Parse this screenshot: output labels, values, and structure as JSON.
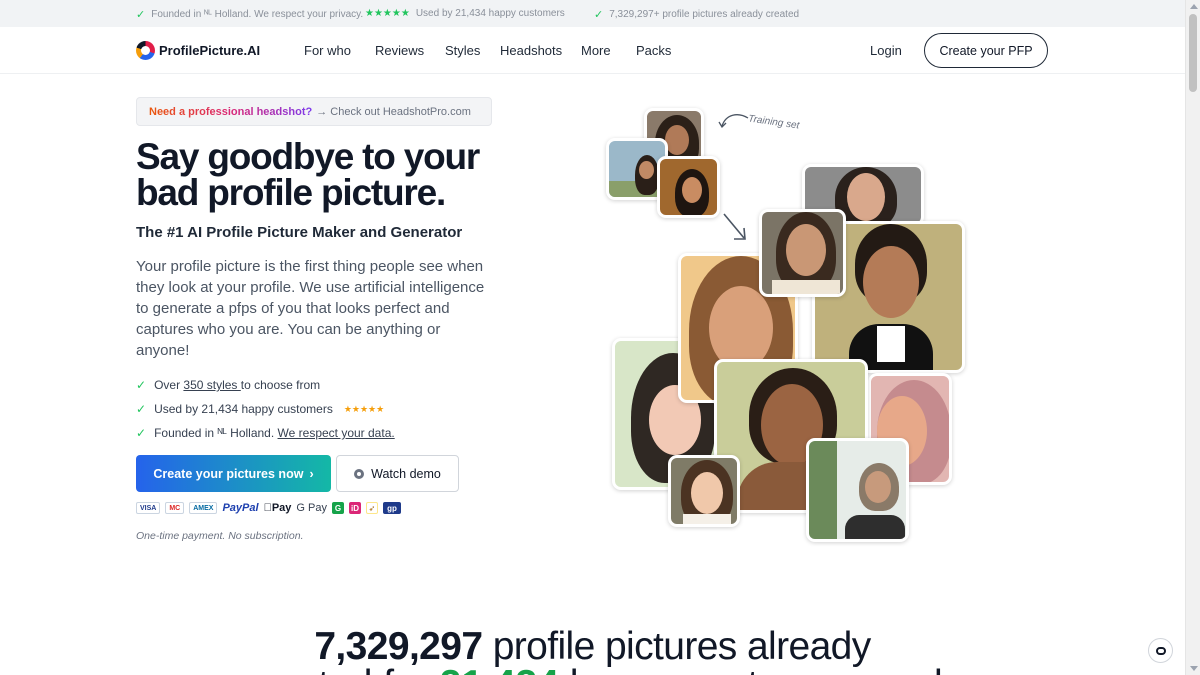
{
  "topbar": {
    "item1": "Founded in ᴺᴸ Holland. We respect your privacy.",
    "item2_stars": "★★★★★",
    "item2": "Used by 21,434 happy customers",
    "item3": "7,329,297+ profile pictures already created"
  },
  "nav": {
    "logo": "ProfilePicture.AI",
    "links": [
      "For who",
      "Reviews",
      "Styles",
      "Headshots",
      "More",
      "Packs"
    ],
    "login": "Login",
    "cta": "Create your PFP"
  },
  "hero": {
    "promo_highlight": "Need a professional headshot?",
    "promo_rest": "→ Check out HeadshotPro.com",
    "title": "Say goodbye to your bad profile picture.",
    "subtitle": "The #1 AI Profile Picture Maker and Generator",
    "description": "Your profile picture is the first thing people see when they look at your profile. We use artificial intelligence to generate a pfps of you that looks perfect and captures who you are. You can be anything or anyone!",
    "bullets": [
      {
        "pre": "Over ",
        "link": "350 styles ",
        "post": "to choose from"
      },
      {
        "pre": "Used by 21,434 happy customers",
        "stars": "★★★★★"
      },
      {
        "pre": "Founded in ᴺᴸ Holland. ",
        "link": "We respect your data."
      }
    ],
    "primary_button": "Create your pictures now",
    "primary_chevron": "›",
    "secondary_button": "Watch demo",
    "payments": {
      "visa": "VISA",
      "mc": "MC",
      "amex": "AMEX",
      "paypal": "PayPal",
      "applepay": "Pay",
      "gpay": "G Pay",
      "g": "G",
      "ideal": "iD",
      "gp": "gp"
    },
    "note": "One-time payment. No subscription."
  },
  "collage": {
    "training_label": "Training set"
  },
  "stats": {
    "number": "7,329,297",
    "line1_rest": " profile pictures already",
    "line2_pre": "created for ",
    "line2_green": "21,434",
    "line2_post": " happy customers and"
  },
  "colors": {
    "accent_green": "#22c55e",
    "primary_gradient_start": "#2563eb",
    "primary_gradient_end": "#14b8a6"
  }
}
